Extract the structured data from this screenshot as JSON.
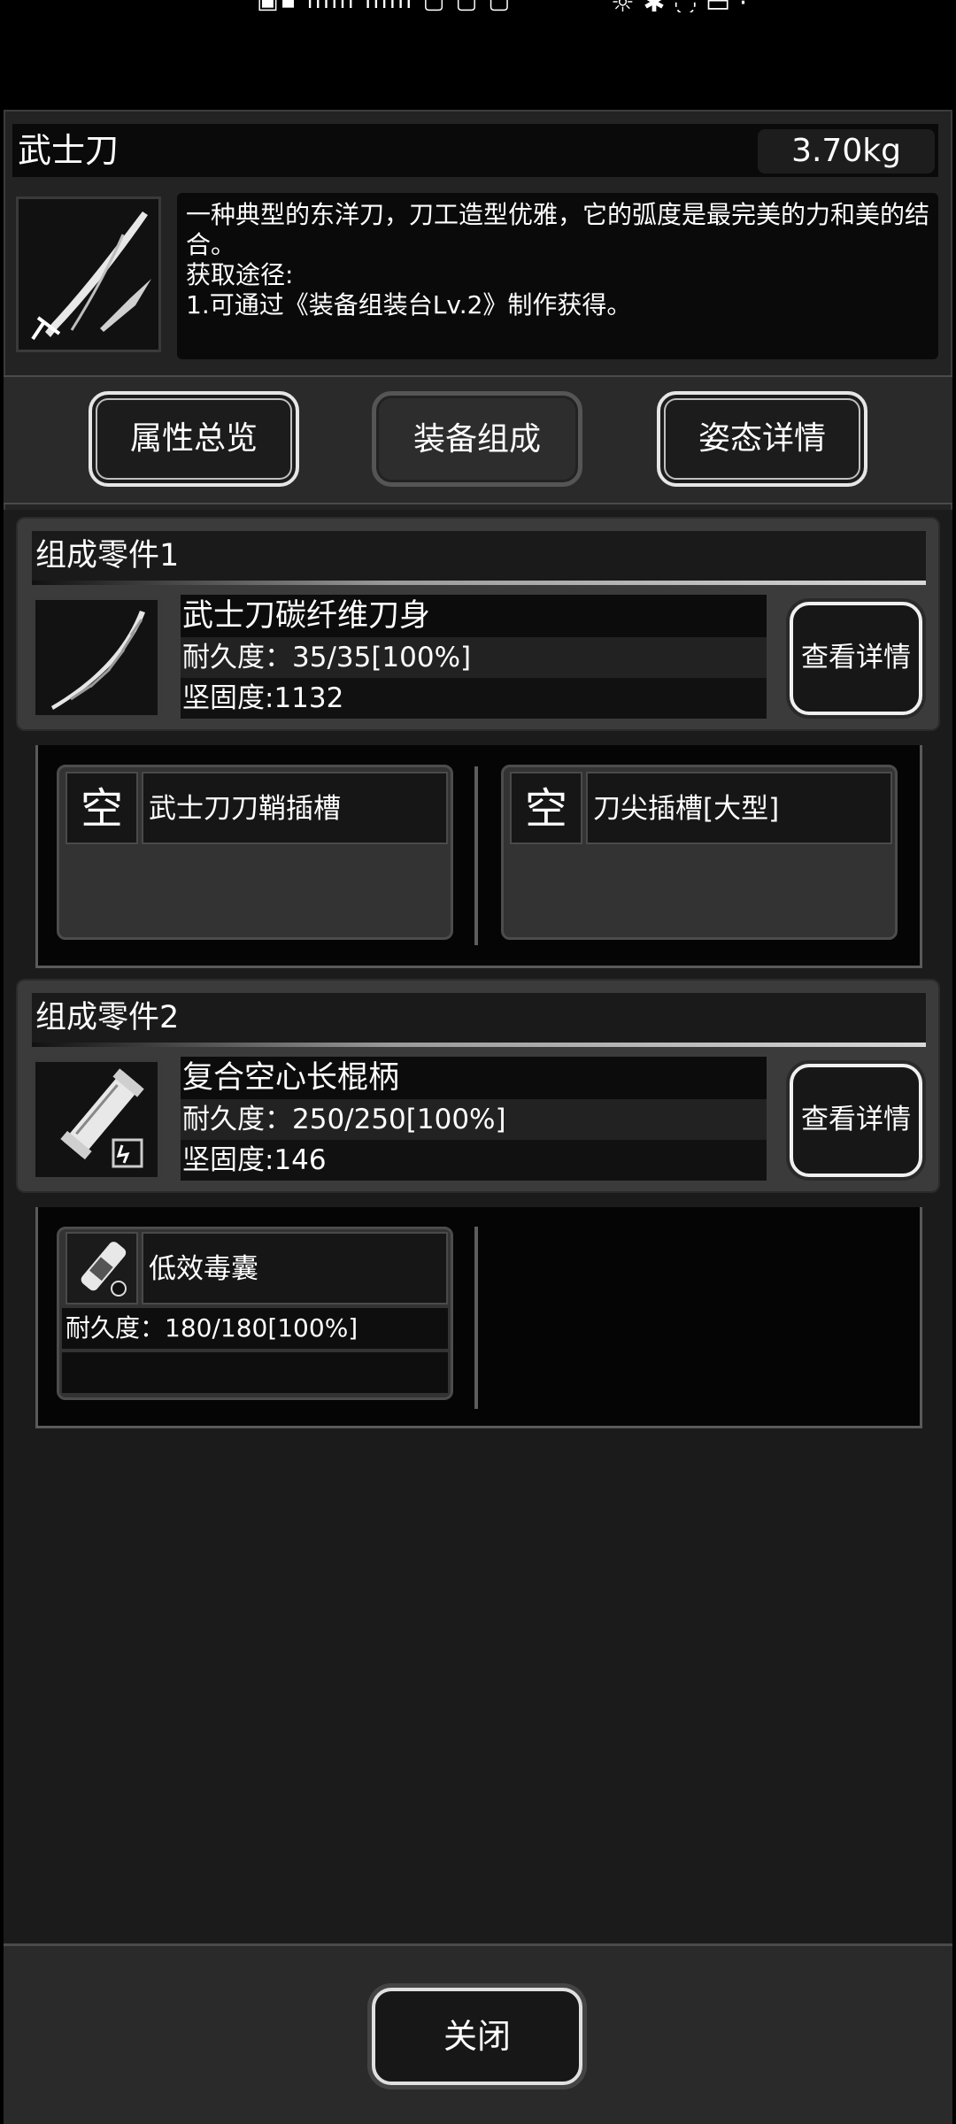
{
  "item": {
    "title": "武士刀",
    "weight": "3.70kg",
    "description": "一种典型的东洋刀，刀工造型优雅，它的弧度是最完美的力和美的结合。\n获取途径:\n1.可通过《装备组装台Lv.2》制作获得。"
  },
  "tabs": [
    {
      "label": "属性总览"
    },
    {
      "label": "装备组成",
      "active": true
    },
    {
      "label": "姿态详情"
    }
  ],
  "parts": [
    {
      "header": "组成零件1",
      "name": "武士刀碳纤维刀身",
      "durability": "耐久度：35/35[100%]",
      "hardness": "坚固度:1132",
      "detail_label": "查看详情",
      "icon": "katana-blade-icon",
      "slots": [
        {
          "status": "空",
          "label": "武士刀刀鞘插槽"
        },
        {
          "status": "空",
          "label": "刀尖插槽[大型]"
        }
      ]
    },
    {
      "header": "组成零件2",
      "name": "复合空心长棍柄",
      "durability": "耐久度：250/250[100%]",
      "hardness": "坚固度:146",
      "detail_label": "查看详情",
      "icon": "hollow-handle-icon",
      "slots": [
        {
          "label": "低效毒囊",
          "durability": "耐久度：180/180[100%]",
          "icon": "poison-sac-icon"
        }
      ]
    }
  ],
  "close_label": "关闭",
  "colors": {
    "background": "#000000",
    "panel": "#232323",
    "card": "#3b3b3b",
    "text": "#ffffff"
  }
}
